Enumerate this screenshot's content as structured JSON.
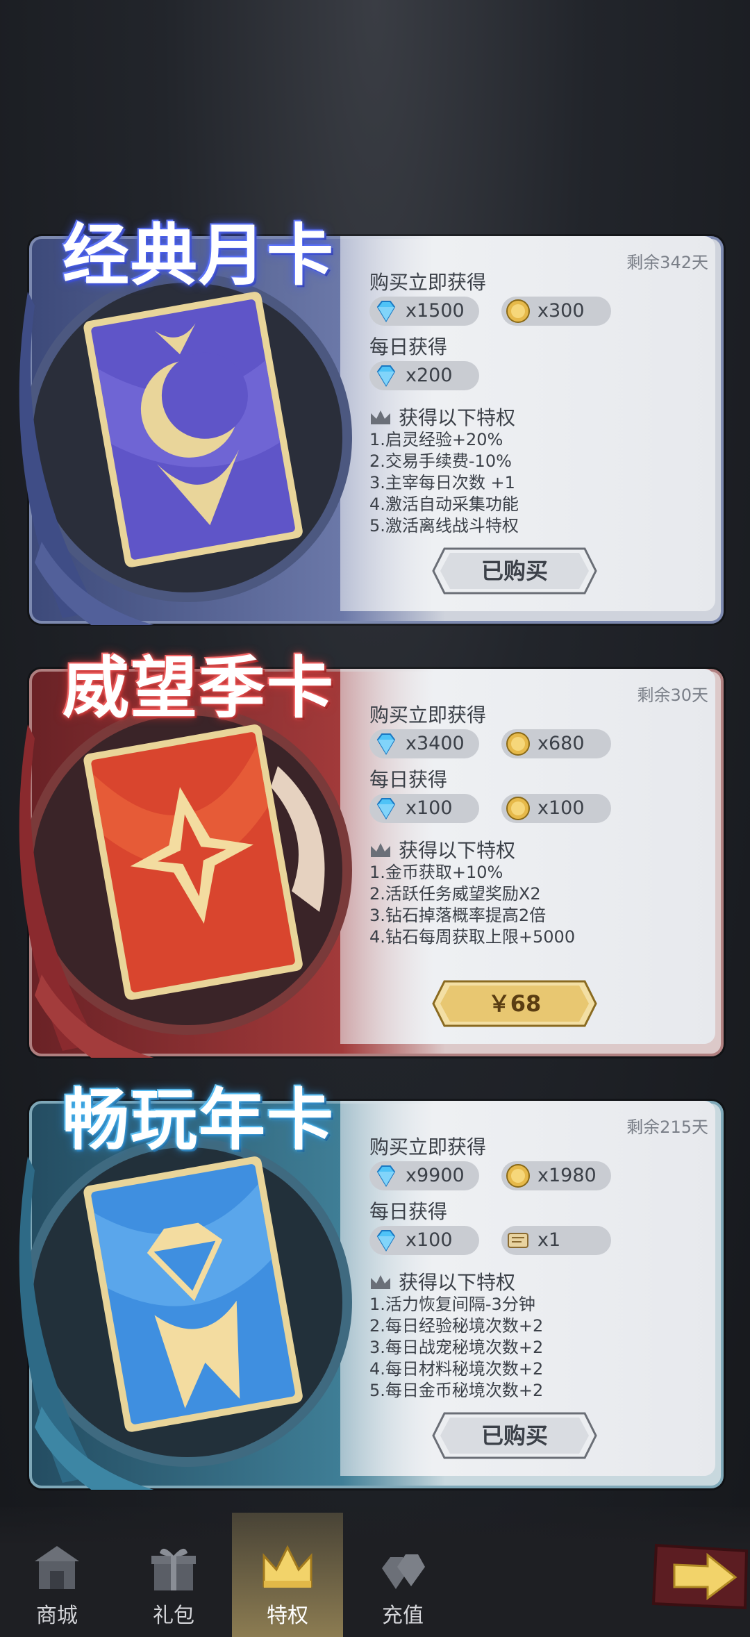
{
  "cards": [
    {
      "title": "经典月卡",
      "remaining": "剩余342天",
      "instant_label": "购买立即获得",
      "instant": [
        {
          "icon": "diamond-icon",
          "value": "x1500"
        },
        {
          "icon": "coin-icon",
          "value": "x300"
        }
      ],
      "daily_label": "每日获得",
      "daily": [
        {
          "icon": "diamond-icon",
          "value": "x200"
        }
      ],
      "perks_label": "获得以下特权",
      "perks": [
        "1.启灵经验+20%",
        "2.交易手续费-10%",
        "3.主宰每日次数 +1",
        "4.激活自动采集功能",
        "5.激活离线战斗特权"
      ],
      "button": "已购买",
      "button_state": "purchased"
    },
    {
      "title": "威望季卡",
      "remaining": "剩余30天",
      "instant_label": "购买立即获得",
      "instant": [
        {
          "icon": "diamond-icon",
          "value": "x3400"
        },
        {
          "icon": "coin-icon",
          "value": "x680"
        }
      ],
      "daily_label": "每日获得",
      "daily": [
        {
          "icon": "diamond-icon",
          "value": "x100"
        },
        {
          "icon": "coin-icon",
          "value": "x100"
        }
      ],
      "perks_label": "获得以下特权",
      "perks": [
        "1.金币获取+10%",
        "2.活跃任务威望奖励X2",
        "3.钻石掉落概率提高2倍",
        "4.钻石每周获取上限+5000"
      ],
      "button": "￥68",
      "button_state": "buy"
    },
    {
      "title": "畅玩年卡",
      "remaining": "剩余215天",
      "instant_label": "购买立即获得",
      "instant": [
        {
          "icon": "diamond-icon",
          "value": "x9900"
        },
        {
          "icon": "coin-icon",
          "value": "x1980"
        }
      ],
      "daily_label": "每日获得",
      "daily": [
        {
          "icon": "diamond-icon",
          "value": "x100"
        },
        {
          "icon": "scroll-icon",
          "value": "x1"
        }
      ],
      "perks_label": "获得以下特权",
      "perks": [
        "1.活力恢复间隔-3分钟",
        "2.每日经验秘境次数+2",
        "3.每日战宠秘境次数+2",
        "4.每日材料秘境次数+2",
        "5.每日金币秘境次数+2"
      ],
      "button": "已购买",
      "button_state": "purchased"
    }
  ],
  "nav": {
    "tabs": [
      {
        "label": "商城",
        "icon": "shop-icon"
      },
      {
        "label": "礼包",
        "icon": "gift-icon"
      },
      {
        "label": "特权",
        "icon": "crown-icon",
        "active": true
      },
      {
        "label": "充值",
        "icon": "diamond-pile-icon"
      }
    ],
    "next_icon": "arrow-right-icon"
  },
  "colors": {
    "card1": "#4a57b8",
    "card2": "#b83a30",
    "card3": "#3b8fb8",
    "gold": "#d9b45a"
  }
}
